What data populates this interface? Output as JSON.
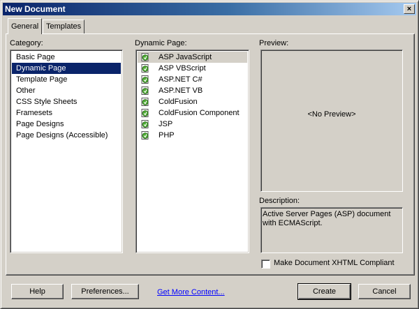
{
  "window": {
    "title": "New Document",
    "close_glyph": "×"
  },
  "tabs": [
    {
      "label": "General",
      "active": true
    },
    {
      "label": "Templates",
      "active": false
    }
  ],
  "category": {
    "label": "Category:",
    "items": [
      "Basic Page",
      "Dynamic Page",
      "Template Page",
      "Other",
      "CSS Style Sheets",
      "Framesets",
      "Page Designs",
      "Page Designs (Accessible)"
    ],
    "selected": "Dynamic Page"
  },
  "dynamic_page": {
    "label": "Dynamic Page:",
    "items": [
      "ASP JavaScript",
      "ASP VBScript",
      "ASP.NET C#",
      "ASP.NET VB",
      "ColdFusion",
      "ColdFusion Component",
      "JSP",
      "PHP"
    ],
    "selected": "ASP JavaScript",
    "icon": "dynamic-page-file-icon"
  },
  "preview": {
    "label": "Preview:",
    "text": "<No Preview>"
  },
  "description": {
    "label": "Description:",
    "text": "Active Server Pages (ASP) document with ECMAScript."
  },
  "xhtml": {
    "label": "Make Document XHTML Compliant",
    "checked": false
  },
  "buttons": {
    "help": "Help",
    "preferences": "Preferences...",
    "get_more_content": "Get More Content...",
    "create": "Create",
    "cancel": "Cancel"
  },
  "colors": {
    "title_bar": "#0a246a",
    "selection": "#0a246a",
    "link": "#0000ff",
    "face": "#d4d0c8"
  }
}
